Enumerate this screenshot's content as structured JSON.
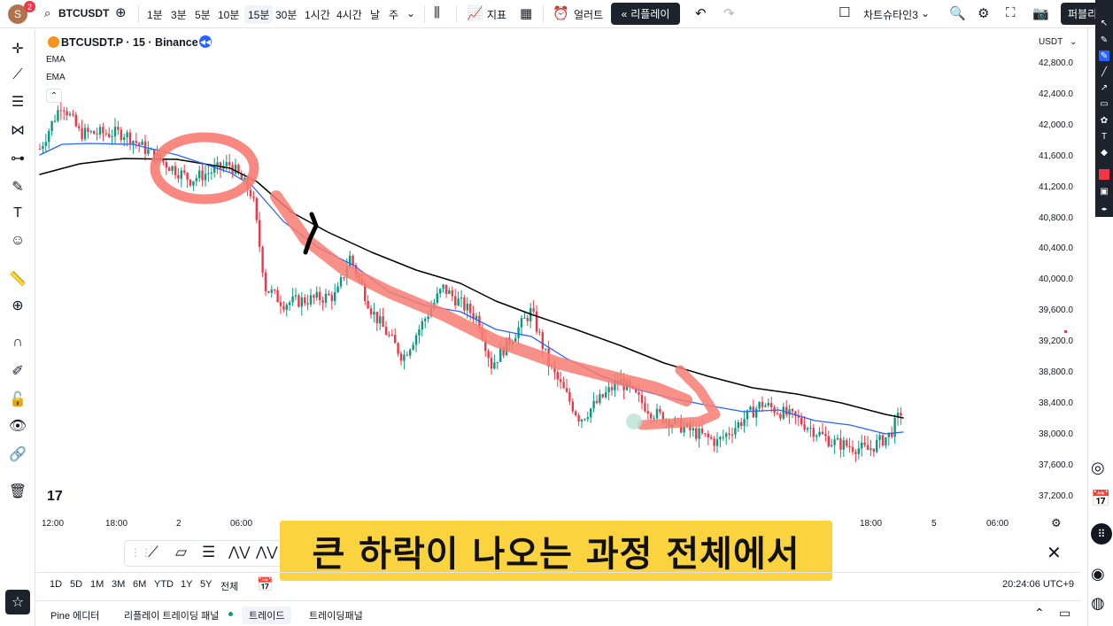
{
  "topbar": {
    "avatar_letter": "S",
    "avatar_badge": "2",
    "symbol": "BTCUSDT",
    "intervals": [
      "1분",
      "3분",
      "5분",
      "10분",
      "15분",
      "30분",
      "1시간",
      "4시간",
      "날",
      "주"
    ],
    "active_interval": "15분",
    "indicators_label": "지표",
    "alert_label": "얼러트",
    "replay_label": "리플레이",
    "layout_name": "차트슈타인3",
    "publish_label": "퍼블리"
  },
  "chart": {
    "title": "BTCUSDT.P · 15 · Binance",
    "ema_labels": [
      "EMA",
      "EMA"
    ],
    "currency": "USDT",
    "price_ticks": [
      "42,800.0",
      "42,400.0",
      "42,000.0",
      "41,600.0",
      "41,200.0",
      "40,800.0",
      "40,400.0",
      "40,000.0",
      "39,600.0",
      "39,200.0",
      "38,800.0",
      "38,400.0",
      "38,000.0",
      "37,600.0",
      "37,200.0"
    ],
    "time_ticks": [
      "12:00",
      "18:00",
      "2",
      "06:00",
      "18:00",
      "5",
      "06:00"
    ],
    "colors": {
      "ema_fast": "#2962ff",
      "ema_slow": "#000000",
      "up": "#089981",
      "down": "#f23645",
      "annotation": "#f87c72"
    }
  },
  "subtitle": "큰 하락이 나오는 과정 전체에서",
  "periods": [
    "1D",
    "5D",
    "1M",
    "3M",
    "6M",
    "YTD",
    "1Y",
    "5Y",
    "전체"
  ],
  "clock": "20:24:06 UTC+9",
  "bottom_tabs": [
    "Pine 에디터",
    "리플레이 트레이딩 패널",
    "트레이드",
    "트레이딩패널"
  ]
}
